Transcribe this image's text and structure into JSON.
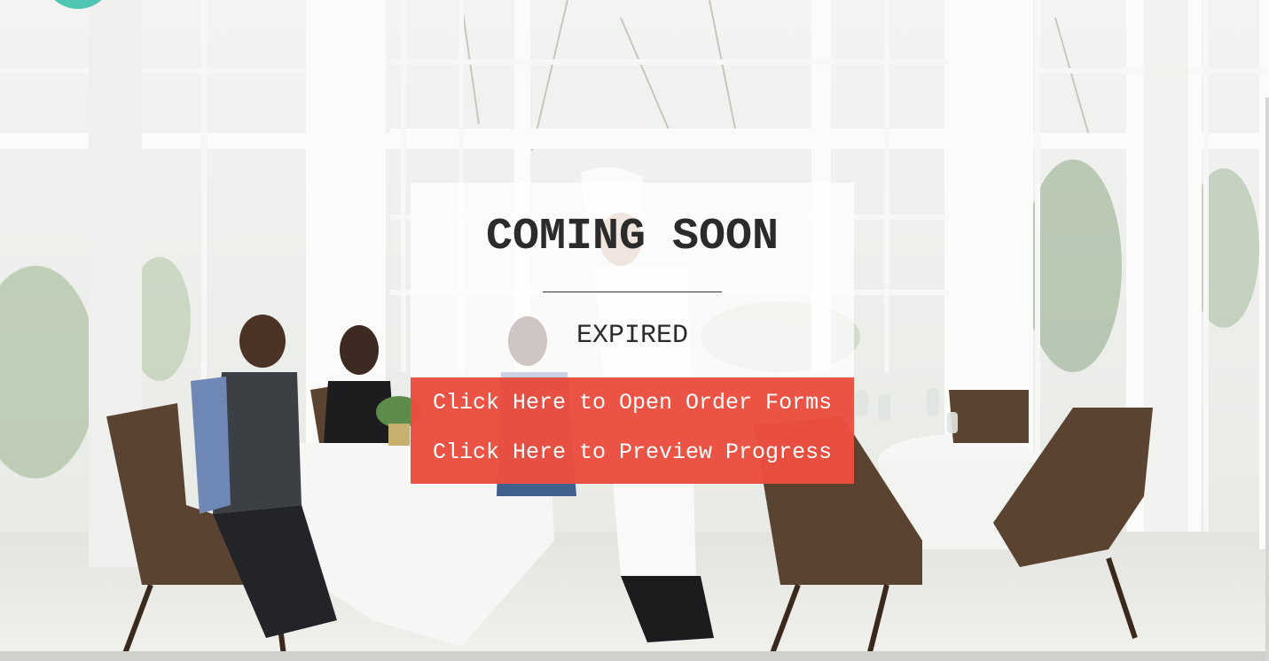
{
  "hero": {
    "headline": "COMING SOON",
    "status": "EXPIRED"
  },
  "actions": {
    "open_order_forms": "Click Here to Open Order Forms",
    "preview_progress": "Click Here to Preview Progress"
  },
  "colors": {
    "brand_accent": "#4fc6b1",
    "action_background": "#e94030",
    "card_background": "#ffffff",
    "text_dark": "#2b2b2b"
  },
  "icons": {
    "logo": "logo-circle"
  }
}
